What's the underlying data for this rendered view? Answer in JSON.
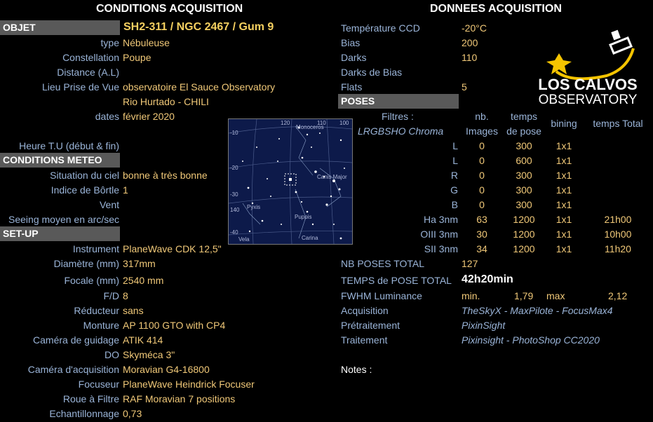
{
  "titles": {
    "left": "CONDITIONS ACQUISITION",
    "right": "DONNEES ACQUISITION"
  },
  "objet": {
    "header": "OBJET",
    "value": "SH2-311 / NGC 2467 / Gum 9"
  },
  "left_rows": [
    {
      "label": "type",
      "value": "Nébuleuse"
    },
    {
      "label": "Constellation",
      "value": "Poupe"
    },
    {
      "label": "Distance (A.L)",
      "value": ""
    },
    {
      "label": "Lieu Prise de Vue",
      "value": "observatoire El Sauce Observatory"
    },
    {
      "label": "",
      "value": "Rio Hurtado - CHILI"
    },
    {
      "label": "dates",
      "value": "février 2020"
    },
    {
      "label": "Heure T.U (début & fin)",
      "value": ""
    }
  ],
  "meteo": {
    "header": "CONDITIONS METEO",
    "rows": [
      {
        "label": "Situation du ciel",
        "value": "bonne à très bonne"
      },
      {
        "label": "Indice de Bôrtle",
        "value": "1"
      },
      {
        "label": "Vent",
        "value": ""
      },
      {
        "label": "Seeing moyen en arc/sec",
        "value": ""
      }
    ]
  },
  "setup": {
    "header": "SET-UP",
    "rows": [
      {
        "label": "Instrument",
        "value": "PlaneWave CDK 12,5\""
      },
      {
        "label": "Diamètre (mm)",
        "value": "317mm"
      },
      {
        "label": "Focale (mm)",
        "value": "2540 mm"
      },
      {
        "label": "F/D",
        "value": "8"
      },
      {
        "label": "Réducteur",
        "value": "sans"
      },
      {
        "label": "Monture",
        "value": "AP 1100 GTO with CP4"
      },
      {
        "label": "Caméra de guidage",
        "value": "ATIK 414"
      },
      {
        "label": "DO",
        "value": "Skyméca 3\""
      },
      {
        "label": "Caméra d'acquisition",
        "value": "Moravian G4-16800"
      },
      {
        "label": "Focuseur",
        "value": "PlaneWave Heindrick Focuser"
      },
      {
        "label": "Roue à Filtre",
        "value": "RAF Moravian 7 positions"
      },
      {
        "label": "Echantillonnage",
        "value": "0,73"
      }
    ]
  },
  "donnees": [
    {
      "label": "Température CCD",
      "value": "-20°C"
    },
    {
      "label": "Bias",
      "value": "200"
    },
    {
      "label": "Darks",
      "value": "110"
    },
    {
      "label": "Darks de Bias",
      "value": ""
    },
    {
      "label": "Flats",
      "value": "5"
    }
  ],
  "poses": {
    "header": "POSES",
    "filtres_label": "Filtres :",
    "filtres_value": "LRGBSHO Chroma",
    "col_nb": [
      "nb.",
      "Images"
    ],
    "col_temps": [
      "temps",
      "de pose"
    ],
    "col_bining": "bining",
    "col_total": "temps Total",
    "rows": [
      {
        "filter": "L",
        "nb": "0",
        "temps": "300",
        "bin": "1x1",
        "total": ""
      },
      {
        "filter": "L",
        "nb": "0",
        "temps": "600",
        "bin": "1x1",
        "total": ""
      },
      {
        "filter": "R",
        "nb": "0",
        "temps": "300",
        "bin": "1x1",
        "total": ""
      },
      {
        "filter": "G",
        "nb": "0",
        "temps": "300",
        "bin": "1x1",
        "total": ""
      },
      {
        "filter": "B",
        "nb": "0",
        "temps": "300",
        "bin": "1x1",
        "total": ""
      },
      {
        "filter": "Ha 3nm",
        "nb": "63",
        "temps": "1200",
        "bin": "1x1",
        "total": "21h00"
      },
      {
        "filter": "OIII 3nm",
        "nb": "30",
        "temps": "1200",
        "bin": "1x1",
        "total": "10h00"
      },
      {
        "filter": "SII 3nm",
        "nb": "34",
        "temps": "1200",
        "bin": "1x1",
        "total": "11h20"
      }
    ]
  },
  "totals": {
    "nb_label": "NB POSES TOTAL",
    "nb_value": "127",
    "temps_label": "TEMPS de POSE TOTAL",
    "temps_value": "42h20min"
  },
  "fwhm": {
    "label": "FWHM Luminance",
    "min_label": "min.",
    "min_value": "1,79",
    "max_label": "max",
    "max_value": "2,12"
  },
  "software": [
    {
      "label": "Acquisition",
      "value": "TheSkyX - MaxPilote - FocusMax4"
    },
    {
      "label": "Prétraitement",
      "value": "PixinSight"
    },
    {
      "label": "Traitement",
      "value": "Pixinsight - PhotoShop CC2020"
    }
  ],
  "notes_label": "Notes :",
  "map": {
    "constellations": [
      "Monoceros",
      "Canis Major",
      "Pyxis",
      "Puppis",
      "Vela",
      "Carina"
    ],
    "ticks": [
      "120",
      "110",
      "100",
      "-10",
      "-20",
      "-30",
      "140",
      "-40"
    ]
  },
  "logo": {
    "line1": "LOS CALVOS",
    "line2": "OBSERVATORY",
    "accent": "#f5c400"
  }
}
